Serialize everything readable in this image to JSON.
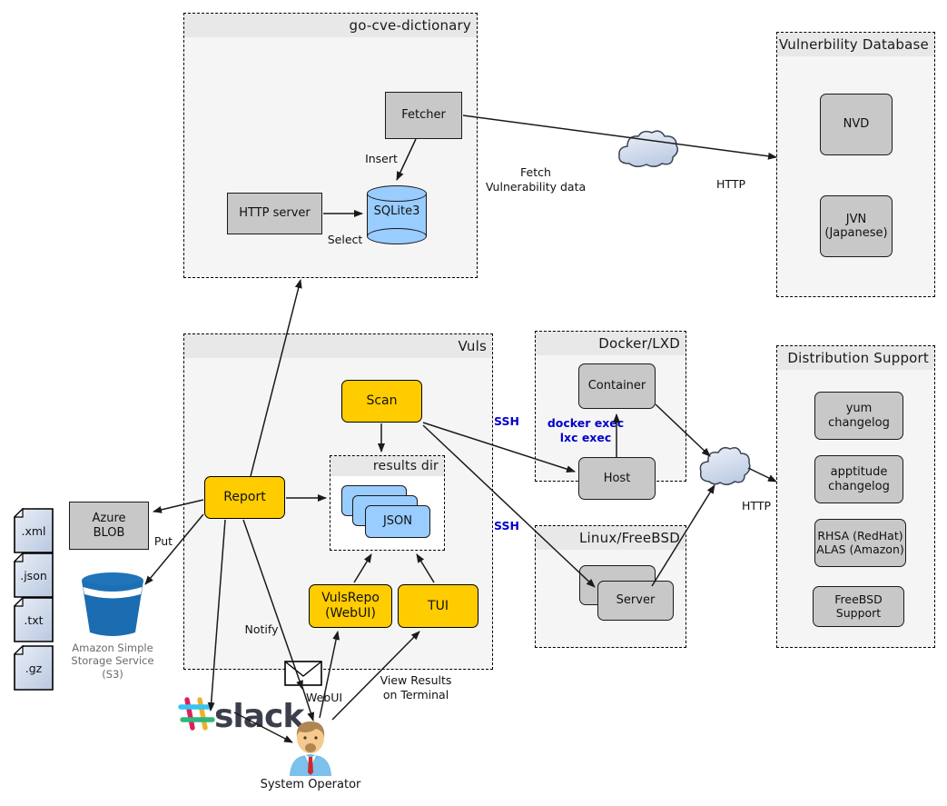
{
  "diagram": {
    "title": "Vuls architecture diagram",
    "colors": {
      "yellow": "#ffcc00",
      "gray_node": "#c8c8c8",
      "blue_node": "#99ccff",
      "group_bg": "#f5f5f5",
      "group_header": "#e8e8e8",
      "accent_blue_text": "#0000cc",
      "cloud": "#ccd9ee",
      "s3_blue": "#1a6fb5"
    }
  },
  "groups": {
    "go_cve_dictionary": {
      "title": "go-cve-dictionary"
    },
    "vulnerability_database": {
      "title": "Vulnerbility Database"
    },
    "vuls": {
      "title": "Vuls"
    },
    "results_dir": {
      "title": "results dir"
    },
    "docker_lxd": {
      "title": "Docker/LXD"
    },
    "linux_freebsd": {
      "title": "Linux/FreeBSD"
    },
    "distribution_support": {
      "title": "Distribution Support"
    }
  },
  "nodes": {
    "fetcher": "Fetcher",
    "http_server": "HTTP server",
    "sqlite3": "SQLite3",
    "nvd": "NVD",
    "jvn": "JVN\n(Japanese)",
    "scan": "Scan",
    "report": "Report",
    "json": "JSON",
    "vulsrepo": "VulsRepo\n(WebUI)",
    "tui": "TUI",
    "container": "Container",
    "host": "Host",
    "server": "Server",
    "azure_blob": "Azure\nBLOB",
    "yum_changelog": "yum\nchangelog",
    "apptitude_changelog": "apptitude\nchangelog",
    "rhsa_alas": "RHSA (RedHat)\nALAS (Amazon)",
    "freebsd_support": "FreeBSD Support"
  },
  "files": [
    {
      "label": ".xml"
    },
    {
      "label": ".json"
    },
    {
      "label": ".txt"
    },
    {
      "label": ".gz"
    }
  ],
  "edge_labels": {
    "insert": "Insert",
    "select": "Select",
    "fetch_vuln": "Fetch\nVulnerability data",
    "http_top": "HTTP",
    "http_mid": "HTTP",
    "ssh_upper": "SSH",
    "ssh_lower": "SSH",
    "docker_exec": "docker exec\nlxc exec",
    "put": "Put",
    "notify": "Notify",
    "webui": "WebUI",
    "view_results": "View Results\non Terminal"
  },
  "actors": {
    "system_operator": "System Operator",
    "slack": "slack",
    "s3_caption": "Amazon Simple\nStorage Service\n(S3)"
  }
}
